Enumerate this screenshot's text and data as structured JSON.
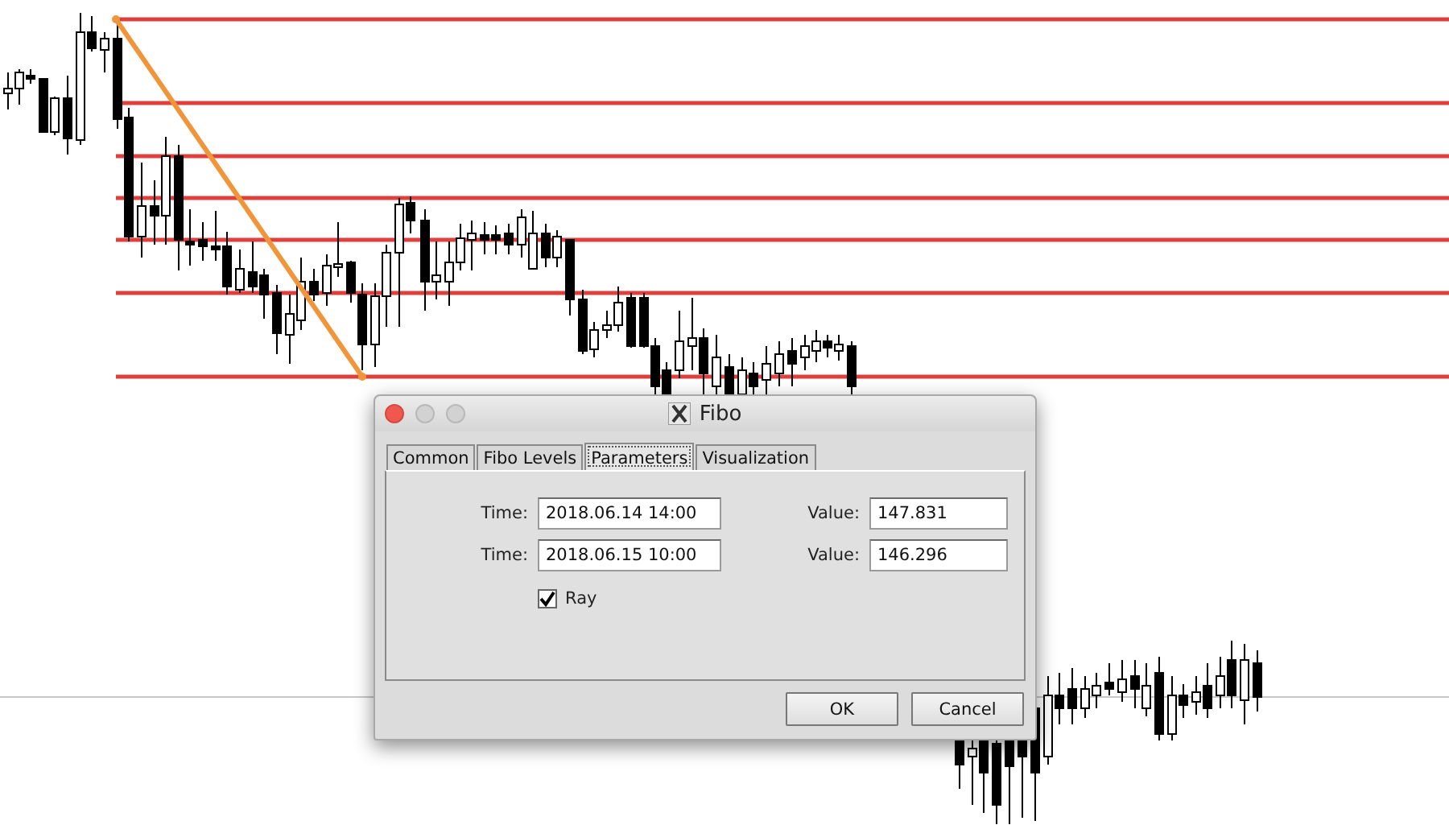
{
  "dialog": {
    "title": "Fibo",
    "tabs": [
      {
        "label": "Common",
        "selected": false
      },
      {
        "label": "Fibo Levels",
        "selected": false
      },
      {
        "label": "Parameters",
        "selected": true
      },
      {
        "label": "Visualization",
        "selected": false
      }
    ],
    "points": [
      {
        "time_label": "Time:",
        "time": "2018.06.14 14:00",
        "value_label": "Value:",
        "value": "147.831"
      },
      {
        "time_label": "Time:",
        "time": "2018.06.15 10:00",
        "value_label": "Value:",
        "value": "146.296"
      }
    ],
    "ray": {
      "label": "Ray",
      "checked": true
    },
    "buttons": [
      "OK",
      "Cancel"
    ]
  }
}
